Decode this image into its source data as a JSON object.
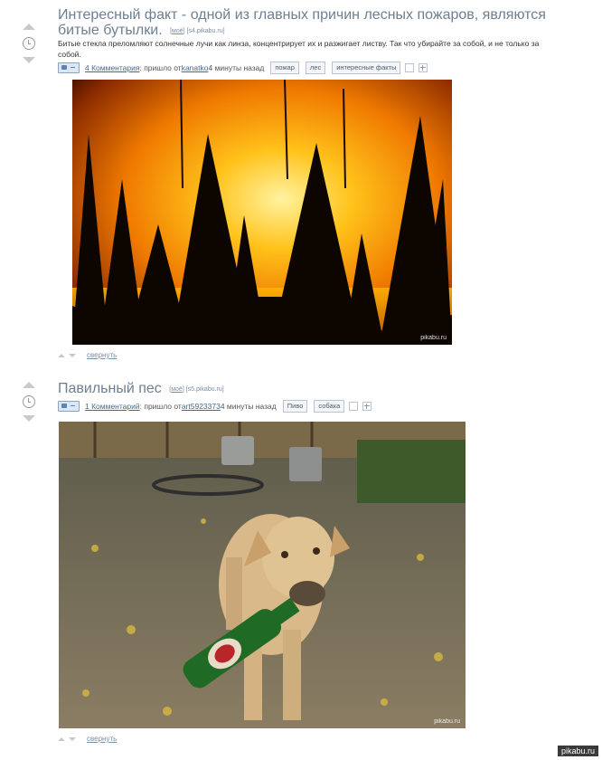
{
  "posts": [
    {
      "title": "Интересный факт - одной из главных причин лесных пожаров, являются битые бутылки.",
      "source_moe": "моё",
      "source_host": "[s4.pikabu.ru]",
      "description": "Битые стекла преломляют солнечные лучи как линза, концентрирует их и разжигает листву. Так что убирайте за собой, и не только за собой.",
      "comments": "4 Комментария",
      "from_text": ": пришло от ",
      "author": "kanatko",
      "time": " 4 минуты назад",
      "tags": [
        "пожар",
        "лес",
        "интересные факты"
      ],
      "watermark": "pikabu.ru",
      "collapse": "свернуть"
    },
    {
      "title": "Павильный пес",
      "source_moe": "моё",
      "source_host": "[s5.pikabu.ru]",
      "comments": "1 Комментарий",
      "from_text": ": пришло от ",
      "author": "art5923373",
      "time": " 4 минуты назад",
      "tags": [
        "Пиво",
        "собака"
      ],
      "watermark": "pikabu.ru",
      "collapse": "свернуть"
    }
  ],
  "footer_watermark": "pikabu.ru",
  "colors": {
    "link": "#4a6a8a",
    "title": "#6d7f91",
    "tag_border": "#b9c4d0"
  }
}
